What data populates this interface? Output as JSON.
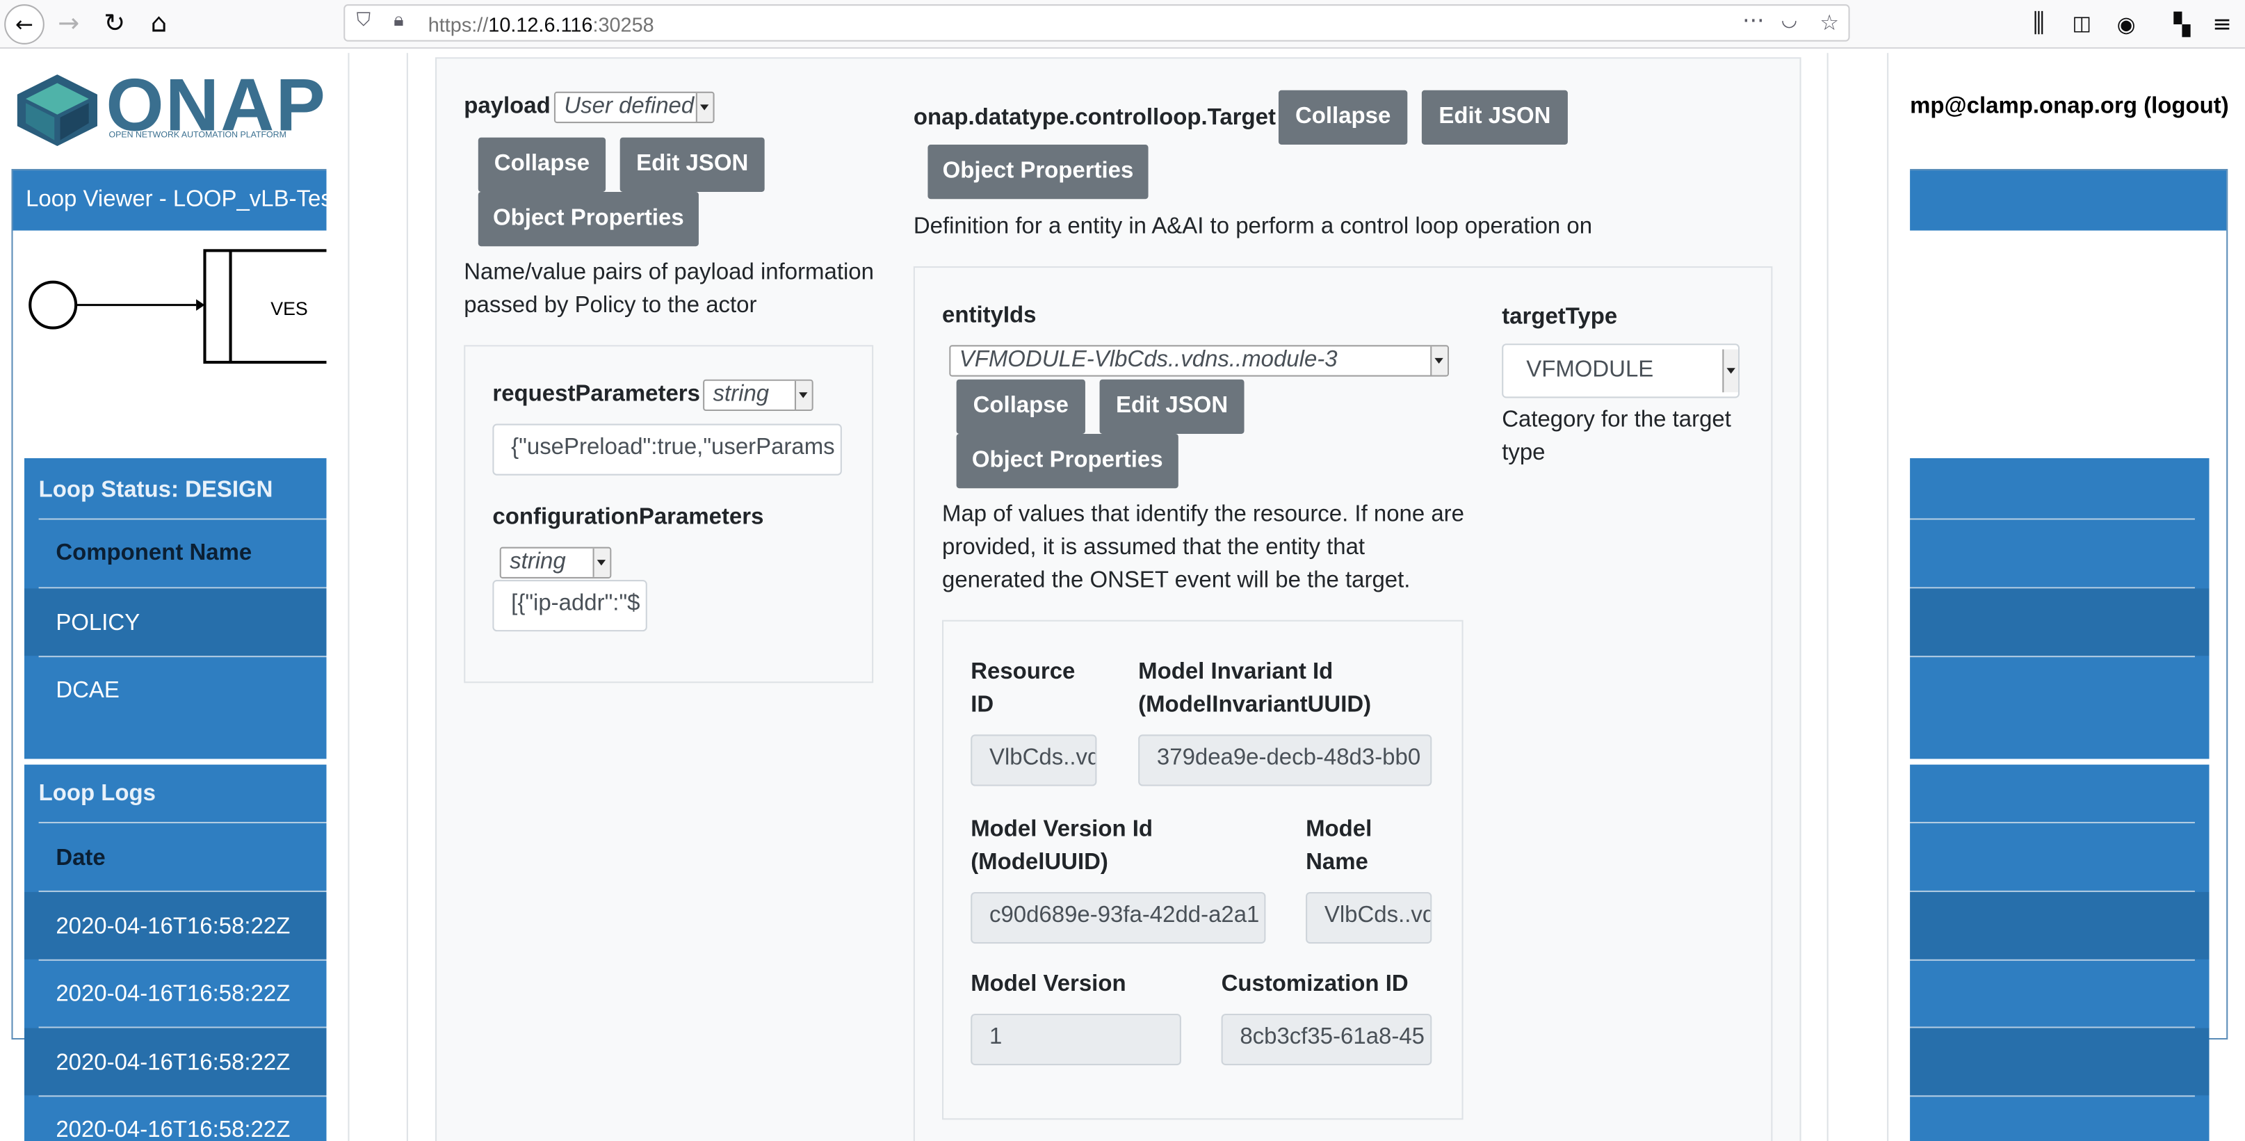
{
  "browser": {
    "url_prefix": "https://",
    "url_host": "10.12.6.116",
    "url_port": ":30258",
    "back_icon": "arrow-left-icon",
    "forward_icon": "arrow-right-icon",
    "reload_icon": "reload-icon",
    "home_icon": "home-icon"
  },
  "background": {
    "logo_text": "ONAP",
    "logo_sub": "OPEN NETWORK AUTOMATION PLATFORM",
    "user_link": "mp@clamp.onap.org (logout)",
    "loop_viewer_title": "Loop Viewer - LOOP_vLB-Test",
    "ves_label": "VES",
    "loop_status_title": "Loop Status: DESIGN",
    "component_header": "Component Name",
    "components": [
      "POLICY",
      "DCAE"
    ],
    "logs_title": "Loop Logs",
    "date_header": "Date",
    "log_dates": [
      "2020-04-16T16:58:22Z",
      "2020-04-16T16:58:22Z",
      "2020-04-16T16:58:22Z",
      "2020-04-16T16:58:22Z"
    ]
  },
  "payload": {
    "label": "payload",
    "type_select": "User defined",
    "collapse": "Collapse",
    "edit_json": "Edit JSON",
    "object_properties": "Object Properties",
    "description": "Name/value pairs of payload information passed by Policy to the actor",
    "request_parameters_label": "requestParameters",
    "request_parameters_type": "string",
    "request_parameters_value": "{\"usePreload\":true,\"userParams",
    "configuration_parameters_label": "configurationParameters",
    "configuration_parameters_type": "string",
    "configuration_parameters_value": "[{\"ip-addr\":\"$"
  },
  "target": {
    "label": "onap.datatype.controlloop.Target",
    "collapse": "Collapse",
    "edit_json": "Edit JSON",
    "object_properties": "Object Properties",
    "description": "Definition for a entity in A&AI to perform a control loop operation on",
    "entity_ids_label": "entityIds",
    "entity_ids_select": "VFMODULE-VlbCds..vdns..module-3",
    "entity_collapse": "Collapse",
    "entity_edit_json": "Edit JSON",
    "entity_object_properties": "Object Properties",
    "entity_description": "Map of values that identify the resource. If none are provided, it is assumed that the entity that generated the ONSET event will be the target.",
    "target_type_label": "targetType",
    "target_type_value": "VFMODULE",
    "target_type_description": "Category for the target type",
    "resource_id_label": "Resource ID",
    "resource_id_value": "VlbCds..vdns..",
    "model_invariant_label": "Model Invariant Id (ModelInvariantUUID)",
    "model_invariant_value": "379dea9e-decb-48d3-bb0",
    "model_version_id_label": "Model Version Id (ModelUUID)",
    "model_version_id_value": "c90d689e-93fa-42dd-a2a1",
    "model_name_label": "Model Name",
    "model_name_value": "VlbCds..vdns..",
    "model_version_label": "Model Version",
    "model_version_value": "1",
    "customization_id_label": "Customization ID",
    "customization_id_value": "8cb3cf35-61a8-45"
  },
  "colors": {
    "button_bg": "#6c757d",
    "panel_blue": "#2f7ec1",
    "card_bg": "#f8f9fa"
  }
}
